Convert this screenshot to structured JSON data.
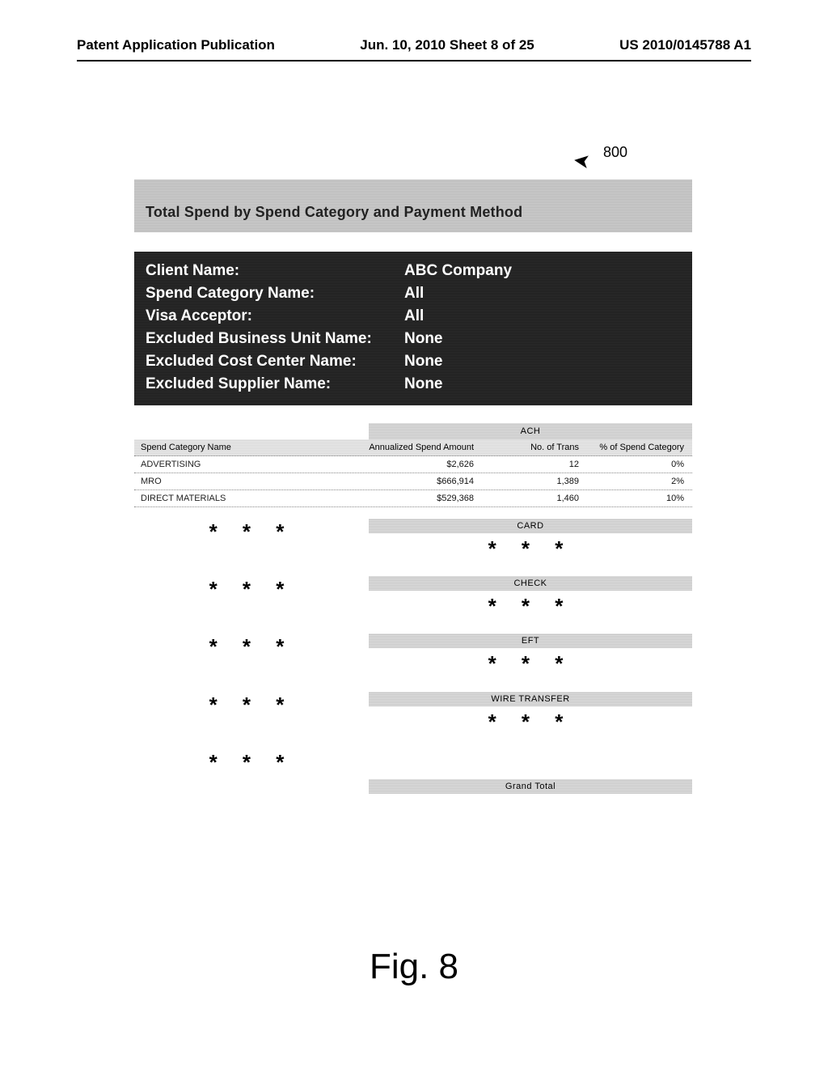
{
  "header": {
    "left": "Patent Application Publication",
    "mid": "Jun. 10, 2010  Sheet 8 of 25",
    "right": "US 2010/0145788 A1"
  },
  "figure_ref": "800",
  "title": "Total Spend by Spend Category and Payment Method",
  "params": [
    {
      "label": "Client Name:",
      "value": "ABC Company"
    },
    {
      "label": "Spend Category Name:",
      "value": "All"
    },
    {
      "label": "Visa Acceptor:",
      "value": "All"
    },
    {
      "label": "Excluded Business Unit Name:",
      "value": "None"
    },
    {
      "label": "Excluded Cost Center Name:",
      "value": "None"
    },
    {
      "label": "Excluded Supplier Name:",
      "value": "None"
    }
  ],
  "table": {
    "group_header": "ACH",
    "columns": {
      "category": "Spend Category Name",
      "annualized": "Annualized Spend Amount",
      "trans": "No. of Trans",
      "pct": "% of Spend Category"
    },
    "rows": [
      {
        "category": "ADVERTISING",
        "annualized": "$2,626",
        "trans": "12",
        "pct": "0%"
      },
      {
        "category": "MRO",
        "annualized": "$666,914",
        "trans": "1,389",
        "pct": "2%"
      },
      {
        "category": "DIRECT MATERIALS",
        "annualized": "$529,368",
        "trans": "1,460",
        "pct": "10%"
      }
    ]
  },
  "omitted_sections": [
    "CARD",
    "CHECK",
    "EFT",
    "WIRE TRANSFER"
  ],
  "grand_total_label": "Grand Total",
  "stars": "* * *",
  "figure_caption": "Fig. 8"
}
